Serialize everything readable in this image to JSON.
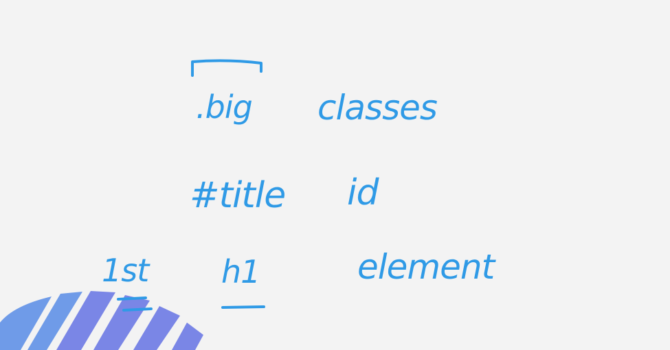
{
  "notes": {
    "row1": {
      "term": ".big",
      "meaning": "classes"
    },
    "row2": {
      "term": "#title",
      "meaning": "id"
    },
    "row3": {
      "rank": "1st",
      "term": "h1",
      "meaning": "element"
    }
  },
  "colors": {
    "background": "#f3f3f3",
    "ink": "#2f9ae6",
    "stripe_primary": "#7a86e6",
    "stripe_secondary": "#6f9be8"
  }
}
